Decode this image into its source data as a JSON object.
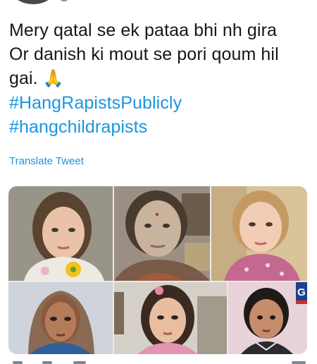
{
  "tweet": {
    "lines": [
      "Mery qatal se ek pataa bhi nh gira",
      "Or danish ki mout se pori qoum hil",
      "gai."
    ],
    "emoji": "🙏",
    "hashtags": [
      "#HangRapistsPublicly",
      "#hangchildrapists"
    ]
  },
  "translate_label": "Translate Tweet",
  "colors": {
    "text": "#14171a",
    "link": "#1b95e0",
    "emoji": "#f4b400"
  },
  "media": {
    "photos": [
      "child-photo-1",
      "child-photo-2",
      "child-photo-3",
      "child-photo-4",
      "child-photo-5",
      "child-photo-6"
    ],
    "channel_logo_text": "G"
  }
}
